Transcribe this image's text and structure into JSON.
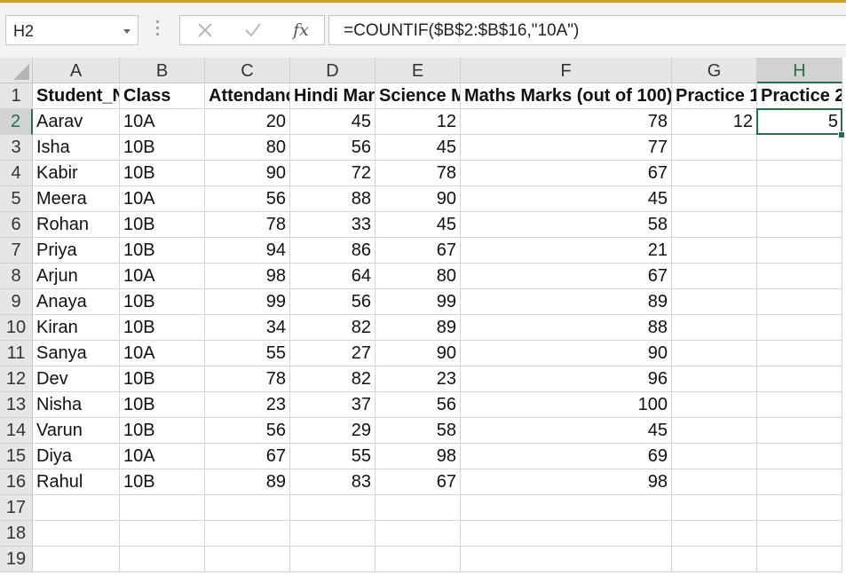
{
  "formula_bar": {
    "name_box": "H2",
    "formula": "=COUNTIF($B$2:$B$16,\"10A\")",
    "fx_label": "fx",
    "icons": [
      "cancel-x-icon",
      "enter-check-icon",
      "function-fx-icon",
      "dropdown-arrow-icon"
    ]
  },
  "grid": {
    "columns": [
      "A",
      "B",
      "C",
      "D",
      "E",
      "F",
      "G",
      "H"
    ],
    "row_numbers": [
      "1",
      "2",
      "3",
      "4",
      "5",
      "6",
      "7",
      "8",
      "9",
      "10",
      "11",
      "12",
      "13",
      "14",
      "15",
      "16",
      "17",
      "18",
      "19"
    ],
    "headers": [
      "Student_Name",
      "Class",
      "Attendance",
      "Hindi Marks",
      "Science Marks",
      "Maths Marks (out of 100)",
      "Practice 1",
      "Practice 2"
    ],
    "rows": [
      [
        "Aarav",
        "10A",
        "20",
        "45",
        "12",
        "78",
        "12",
        "5"
      ],
      [
        "Isha",
        "10B",
        "80",
        "56",
        "45",
        "77",
        "",
        ""
      ],
      [
        "Kabir",
        "10B",
        "90",
        "72",
        "78",
        "67",
        "",
        ""
      ],
      [
        "Meera",
        "10A",
        "56",
        "88",
        "90",
        "45",
        "",
        ""
      ],
      [
        "Rohan",
        "10B",
        "78",
        "33",
        "45",
        "58",
        "",
        ""
      ],
      [
        "Priya",
        "10B",
        "94",
        "86",
        "67",
        "21",
        "",
        ""
      ],
      [
        "Arjun",
        "10A",
        "98",
        "64",
        "80",
        "67",
        "",
        ""
      ],
      [
        "Anaya",
        "10B",
        "99",
        "56",
        "99",
        "89",
        "",
        ""
      ],
      [
        "Kiran",
        "10B",
        "34",
        "82",
        "89",
        "88",
        "",
        ""
      ],
      [
        "Sanya",
        "10A",
        "55",
        "27",
        "90",
        "90",
        "",
        ""
      ],
      [
        "Dev",
        "10B",
        "78",
        "82",
        "23",
        "96",
        "",
        ""
      ],
      [
        "Nisha",
        "10B",
        "23",
        "37",
        "56",
        "100",
        "",
        ""
      ],
      [
        "Varun",
        "10B",
        "56",
        "29",
        "58",
        "45",
        "",
        ""
      ],
      [
        "Diya",
        "10A",
        "67",
        "55",
        "98",
        "69",
        "",
        ""
      ],
      [
        "Rahul",
        "10B",
        "89",
        "83",
        "67",
        "98",
        "",
        ""
      ]
    ],
    "selected_cell": "H2",
    "selected_column": "H",
    "selected_row": "2"
  },
  "colors": {
    "accent": "#217346",
    "header_bg": "#e6e6e6",
    "gridline": "#d4d4d4"
  }
}
